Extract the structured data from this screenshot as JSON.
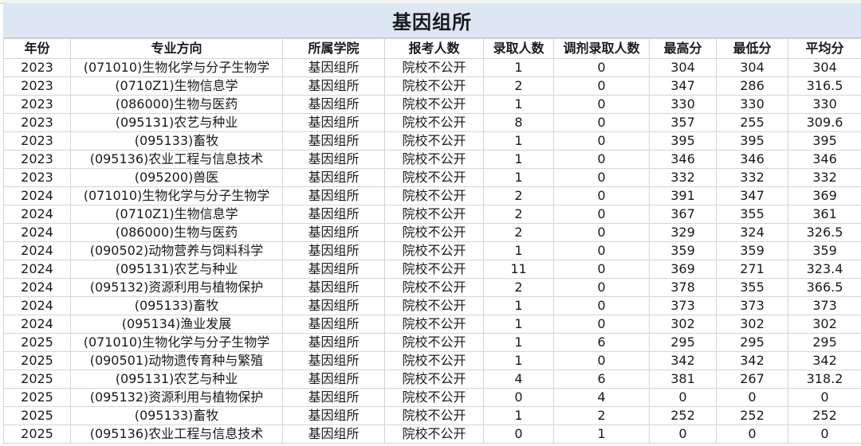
{
  "title": "基因组所",
  "headers": [
    "年份",
    "专业方向",
    "所属学院",
    "报考人数",
    "录取人数",
    "调剂录取人数",
    "最高分",
    "最低分",
    "平均分"
  ],
  "rows": [
    [
      "2023",
      "(071010)生物化学与分子生物学",
      "基因组所",
      "院校不公开",
      "1",
      "0",
      "304",
      "304",
      "304"
    ],
    [
      "2023",
      "(0710Z1)生物信息学",
      "基因组所",
      "院校不公开",
      "2",
      "0",
      "347",
      "286",
      "316.5"
    ],
    [
      "2023",
      "(086000)生物与医药",
      "基因组所",
      "院校不公开",
      "1",
      "0",
      "330",
      "330",
      "330"
    ],
    [
      "2023",
      "(095131)农艺与种业",
      "基因组所",
      "院校不公开",
      "8",
      "0",
      "357",
      "255",
      "309.6"
    ],
    [
      "2023",
      "(095133)畜牧",
      "基因组所",
      "院校不公开",
      "1",
      "0",
      "395",
      "395",
      "395"
    ],
    [
      "2023",
      "(095136)农业工程与信息技术",
      "基因组所",
      "院校不公开",
      "1",
      "0",
      "346",
      "346",
      "346"
    ],
    [
      "2023",
      "(095200)兽医",
      "基因组所",
      "院校不公开",
      "1",
      "0",
      "332",
      "332",
      "332"
    ],
    [
      "2024",
      "(071010)生物化学与分子生物学",
      "基因组所",
      "院校不公开",
      "2",
      "0",
      "391",
      "347",
      "369"
    ],
    [
      "2024",
      "(0710Z1)生物信息学",
      "基因组所",
      "院校不公开",
      "2",
      "0",
      "367",
      "355",
      "361"
    ],
    [
      "2024",
      "(086000)生物与医药",
      "基因组所",
      "院校不公开",
      "2",
      "0",
      "329",
      "324",
      "326.5"
    ],
    [
      "2024",
      "(090502)动物营养与饲料科学",
      "基因组所",
      "院校不公开",
      "1",
      "0",
      "359",
      "359",
      "359"
    ],
    [
      "2024",
      "(095131)农艺与种业",
      "基因组所",
      "院校不公开",
      "11",
      "0",
      "369",
      "271",
      "323.4"
    ],
    [
      "2024",
      "(095132)资源利用与植物保护",
      "基因组所",
      "院校不公开",
      "2",
      "0",
      "378",
      "355",
      "366.5"
    ],
    [
      "2024",
      "(095133)畜牧",
      "基因组所",
      "院校不公开",
      "1",
      "0",
      "373",
      "373",
      "373"
    ],
    [
      "2024",
      "(095134)渔业发展",
      "基因组所",
      "院校不公开",
      "1",
      "0",
      "302",
      "302",
      "302"
    ],
    [
      "2025",
      "(071010)生物化学与分子生物学",
      "基因组所",
      "院校不公开",
      "1",
      "6",
      "295",
      "295",
      "295"
    ],
    [
      "2025",
      "(090501)动物遗传育种与繁殖",
      "基因组所",
      "院校不公开",
      "1",
      "0",
      "342",
      "342",
      "342"
    ],
    [
      "2025",
      "(095131)农艺与种业",
      "基因组所",
      "院校不公开",
      "4",
      "6",
      "381",
      "267",
      "318.2"
    ],
    [
      "2025",
      "(095132)资源利用与植物保护",
      "基因组所",
      "院校不公开",
      "0",
      "4",
      "0",
      "0",
      "0"
    ],
    [
      "2025",
      "(095133)畜牧",
      "基因组所",
      "院校不公开",
      "1",
      "2",
      "252",
      "252",
      "252"
    ],
    [
      "2025",
      "(095136)农业工程与信息技术",
      "基因组所",
      "院校不公开",
      "0",
      "1",
      "0",
      "0",
      "0"
    ]
  ]
}
